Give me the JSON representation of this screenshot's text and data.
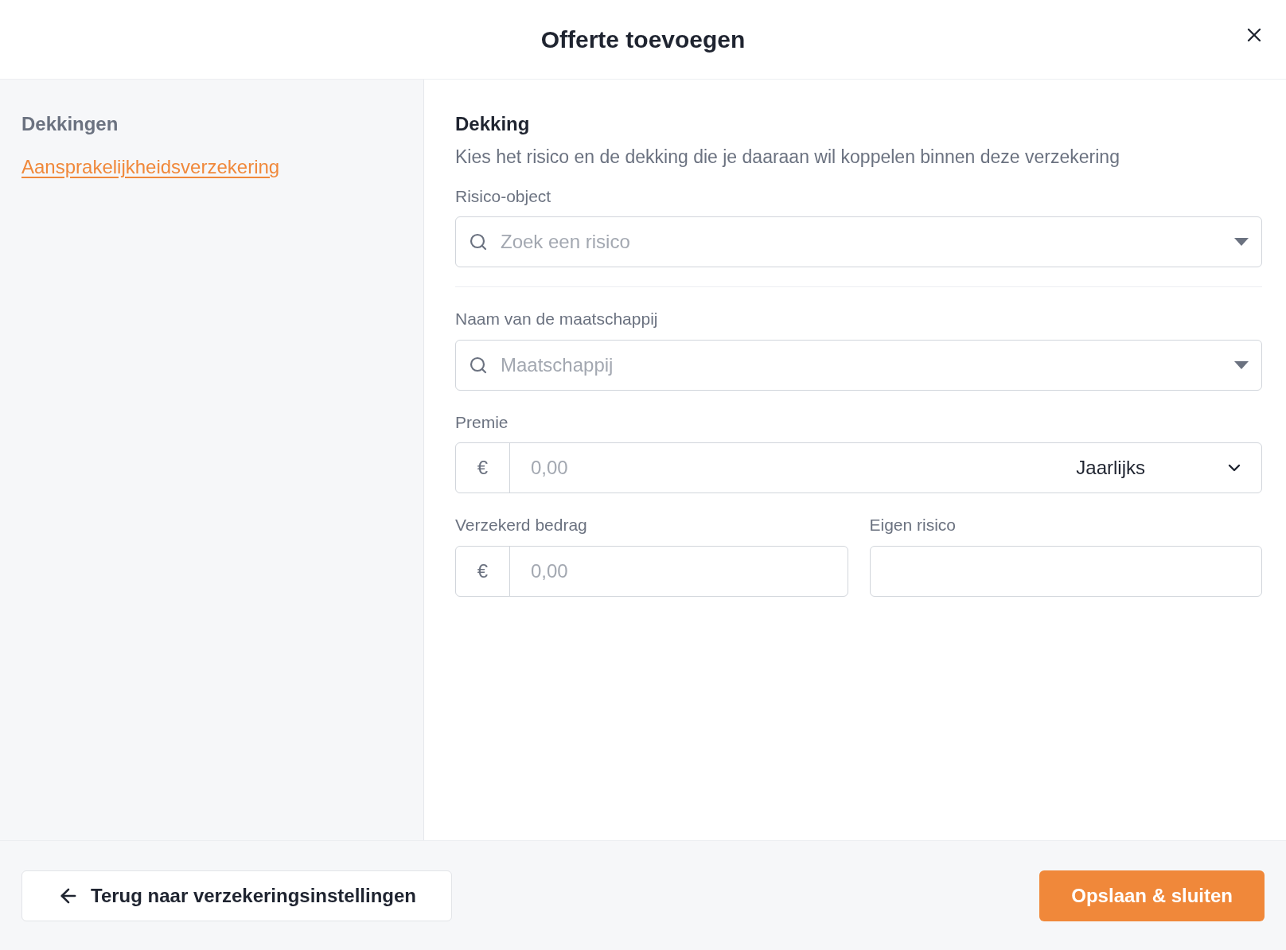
{
  "dialog": {
    "title": "Offerte toevoegen"
  },
  "sidebar": {
    "heading": "Dekkingen",
    "items": [
      {
        "label": "Aansprakelijkheidsverzekering",
        "selected": true
      }
    ]
  },
  "section": {
    "title": "Dekking",
    "description": "Kies het risico en de dekking die je daaraan wil koppelen binnen deze verzekering"
  },
  "risk_object": {
    "label": "Risico-object",
    "placeholder": "Zoek een risico"
  },
  "company": {
    "label": "Naam van de maatschappij",
    "placeholder": "Maatschappij"
  },
  "premium": {
    "label": "Premie",
    "currency": "€",
    "placeholder": "0,00",
    "frequency": "Jaarlijks"
  },
  "insured_amount": {
    "label": "Verzekerd bedrag",
    "currency": "€",
    "placeholder": "0,00"
  },
  "deductible": {
    "label": "Eigen risico"
  },
  "footer": {
    "back_button": "Terug naar verzekeringsinstellingen",
    "save_button": "Opslaan & sluiten"
  }
}
